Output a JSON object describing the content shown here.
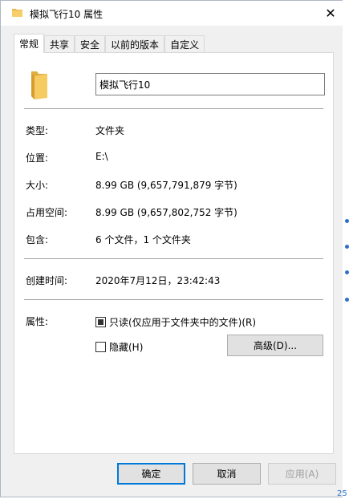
{
  "window": {
    "title": "模拟飞行10 属性",
    "close_glyph": "✕"
  },
  "tabs": [
    "常规",
    "共享",
    "安全",
    "以前的版本",
    "自定义"
  ],
  "general": {
    "name_value": "模拟飞行10",
    "type_label": "类型:",
    "type_value": "文件夹",
    "location_label": "位置:",
    "location_value": "E:\\",
    "size_label": "大小:",
    "size_value": "8.99 GB (9,657,791,879 字节)",
    "size_on_disk_label": "占用空间:",
    "size_on_disk_value": "8.99 GB (9,657,802,752 字节)",
    "contains_label": "包含:",
    "contains_value": "6 个文件，1 个文件夹",
    "created_label": "创建时间:",
    "created_value": "2020年7月12日，23:42:43",
    "attributes_label": "属性:",
    "readonly_label": "只读(仅应用于文件夹中的文件)(R)",
    "readonly_checked": true,
    "hidden_label": "隐藏(H)",
    "hidden_checked": false,
    "advanced_label": "高级(D)..."
  },
  "buttons": {
    "ok": "确定",
    "cancel": "取消",
    "apply": "应用(A)"
  },
  "background": {
    "partial_text": "25"
  },
  "colors": {
    "accent": "#0078d7",
    "folder": "#f3c760"
  }
}
